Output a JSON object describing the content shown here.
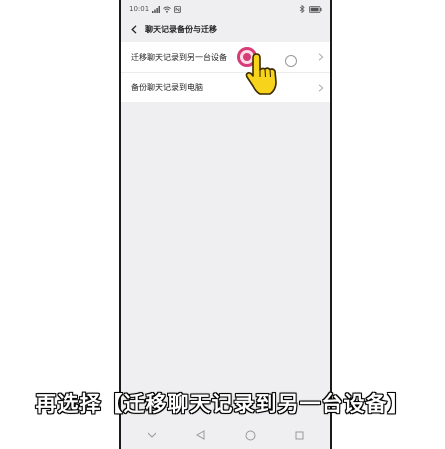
{
  "status_bar": {
    "time": "10:01",
    "icons": [
      "signal-icon",
      "wifi-icon",
      "nfc-icon",
      "bluetooth-icon",
      "battery-icon"
    ]
  },
  "header": {
    "back_icon": "chevron-left-icon",
    "title": "聊天记录备份与迁移"
  },
  "menu": {
    "items": [
      {
        "label": "迁移聊天记录到另一台设备"
      },
      {
        "label": "备份聊天记录到电脑"
      }
    ]
  },
  "overlay": {
    "pointer_icon": "hand-pointer-icon",
    "caption": "再选择【迁移聊天记录到另一台设备】"
  },
  "nav_bar": {
    "icons": [
      "down-chevron-icon",
      "back-triangle-icon",
      "home-circle-icon",
      "recents-square-icon"
    ]
  },
  "colors": {
    "ripple": "#d63c78",
    "hand": "#f7d31c",
    "background": "#efeff1"
  }
}
